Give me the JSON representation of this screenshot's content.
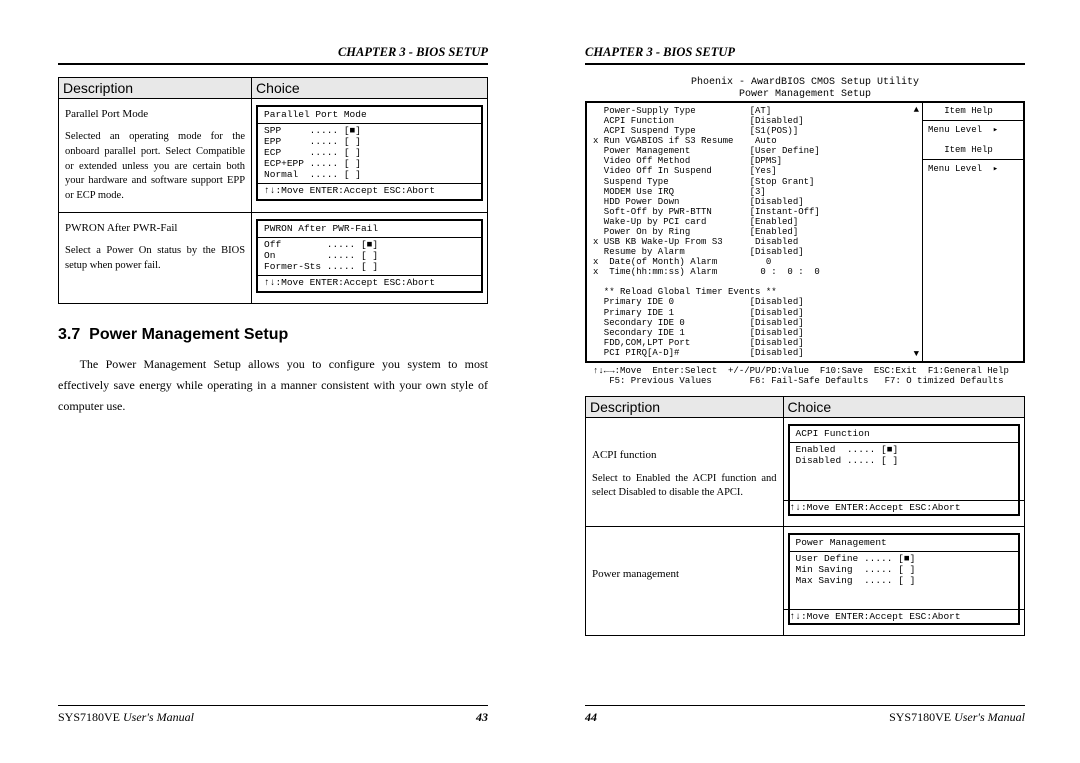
{
  "chapter_header": "CHAPTER 3 - BIOS SETUP",
  "left_page": {
    "table": {
      "headers": {
        "desc": "Description",
        "choice": "Choice"
      },
      "rows": [
        {
          "title": "Parallel Port Mode",
          "desc": "Selected an operating mode for the onboard parallel port. Select Compatible or extended unless you are certain both your hardware and software support EPP or ECP mode.",
          "choice_title": "Parallel Port Mode",
          "options": "SPP     ..... [■]\nEPP     ..... [ ]\nECP     ..... [ ]\nECP+EPP ..... [ ]\nNormal  ..... [ ]",
          "foot": "↑↓:Move ENTER:Accept ESC:Abort"
        },
        {
          "title": "PWRON After PWR-Fail",
          "desc": "Select a Power On status by the BIOS setup when power fail.",
          "choice_title": "PWRON After PWR-Fail",
          "options": "Off        ..... [■]\nOn         ..... [ ]\nFormer-Sts ..... [ ]",
          "foot": "↑↓:Move ENTER:Accept ESC:Abort"
        }
      ]
    },
    "section_no": "3.7",
    "section_title": "Power Management Setup",
    "body": "The Power Management Setup allows you to configure you system to most effectively save energy while operating in a manner consistent with your own style of computer use."
  },
  "right_page": {
    "bios_title": "Phoenix - AwardBIOS CMOS Setup Utility\nPower Management Setup",
    "bios_left": "  Power-Supply Type          [AT]\n  ACPI Function              [Disabled]\n  ACPI Suspend Type          [S1(POS)]\nx Run VGABIOS if S3 Resume    Auto\n  Power Management           [User Define]\n  Video Off Method           [DPMS]\n  Video Off In Suspend       [Yes]\n  Suspend Type               [Stop Grant]\n  MODEM Use IRQ              [3]\n  HDD Power Down             [Disabled]\n  Soft-Off by PWR-BTTN       [Instant-Off]\n  Wake-Up by PCI card        [Enabled]\n  Power On by Ring           [Enabled]\nx USB KB Wake-Up From S3      Disabled\n  Resume by Alarm            [Disabled]\nx  Date(of Month) Alarm         0\nx  Time(hh:mm:ss) Alarm        0 :  0 :  0\n\n  ** Reload Global Timer Events **\n  Primary IDE 0              [Disabled]\n  Primary IDE 1              [Disabled]\n  Secondary IDE 0            [Disabled]\n  Secondary IDE 1            [Disabled]\n  FDD,COM,LPT Port           [Disabled]\n  PCI PIRQ[A-D]#             [Disabled]",
    "bios_right_top": "   Item Help",
    "bios_right_m1": "Menu Level  ▸",
    "bios_right_m2": "   Item Help",
    "bios_right_m3": "Menu Level  ▸",
    "bios_help": "↑↓←→:Move  Enter:Select  +/-/PU/PD:Value  F10:Save  ESC:Exit  F1:General Help\n   F5: Previous Values       F6: Fail-Safe Defaults   F7: O timized Defaults",
    "table": {
      "headers": {
        "desc": "Description",
        "choice": "Choice"
      },
      "rows": [
        {
          "title": "ACPI function",
          "desc": "Select to Enabled the ACPI function and select Disabled to disable the APCI.",
          "choice_title": "ACPI Function",
          "options": "Enabled  ..... [■]\nDisabled ..... [ ]",
          "foot": "↑↓:Move ENTER:Accept ESC:Abort"
        },
        {
          "title": "Power management",
          "desc": "",
          "choice_title": "Power Management",
          "options": "User Define ..... [■]\nMin Saving  ..... [ ]\nMax Saving  ..... [ ]",
          "foot": "↑↓:Move ENTER:Accept ESC:Abort"
        }
      ]
    }
  },
  "footer": {
    "manual_prefix": "SYS7180VE",
    "manual_suffix": " User's Manual",
    "page_left": "43",
    "page_right": "44"
  }
}
